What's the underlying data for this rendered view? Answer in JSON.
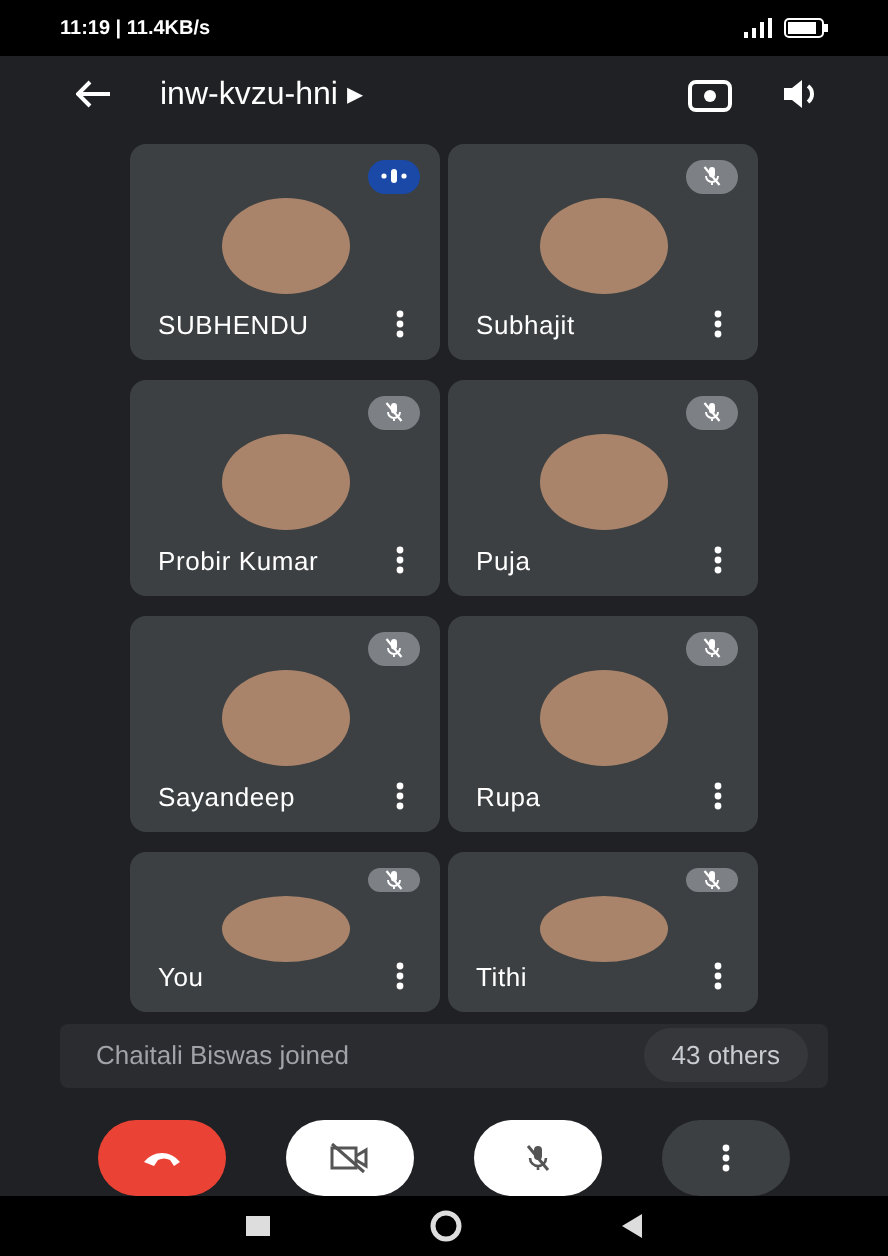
{
  "status_bar": {
    "time": "11:19 | 11.4KB/s"
  },
  "top_bar": {
    "meeting_code": "inw-kvzu-hni ▸"
  },
  "participants": [
    {
      "name": "SUBHENDU",
      "muted": false
    },
    {
      "name": "Subhajit",
      "muted": true
    },
    {
      "name": "Probir Kumar",
      "muted": true
    },
    {
      "name": "Puja",
      "muted": true
    },
    {
      "name": "Sayandeep",
      "muted": true
    },
    {
      "name": "Rupa",
      "muted": true
    },
    {
      "name": "You",
      "muted": true
    },
    {
      "name": "Tithi",
      "muted": true
    }
  ],
  "toast": {
    "message": "Chaitali Biswas joined",
    "others": "43 others"
  },
  "controls": [
    {
      "kind": "end"
    },
    {
      "kind": "camera"
    },
    {
      "kind": "mic"
    },
    {
      "kind": "more"
    }
  ]
}
